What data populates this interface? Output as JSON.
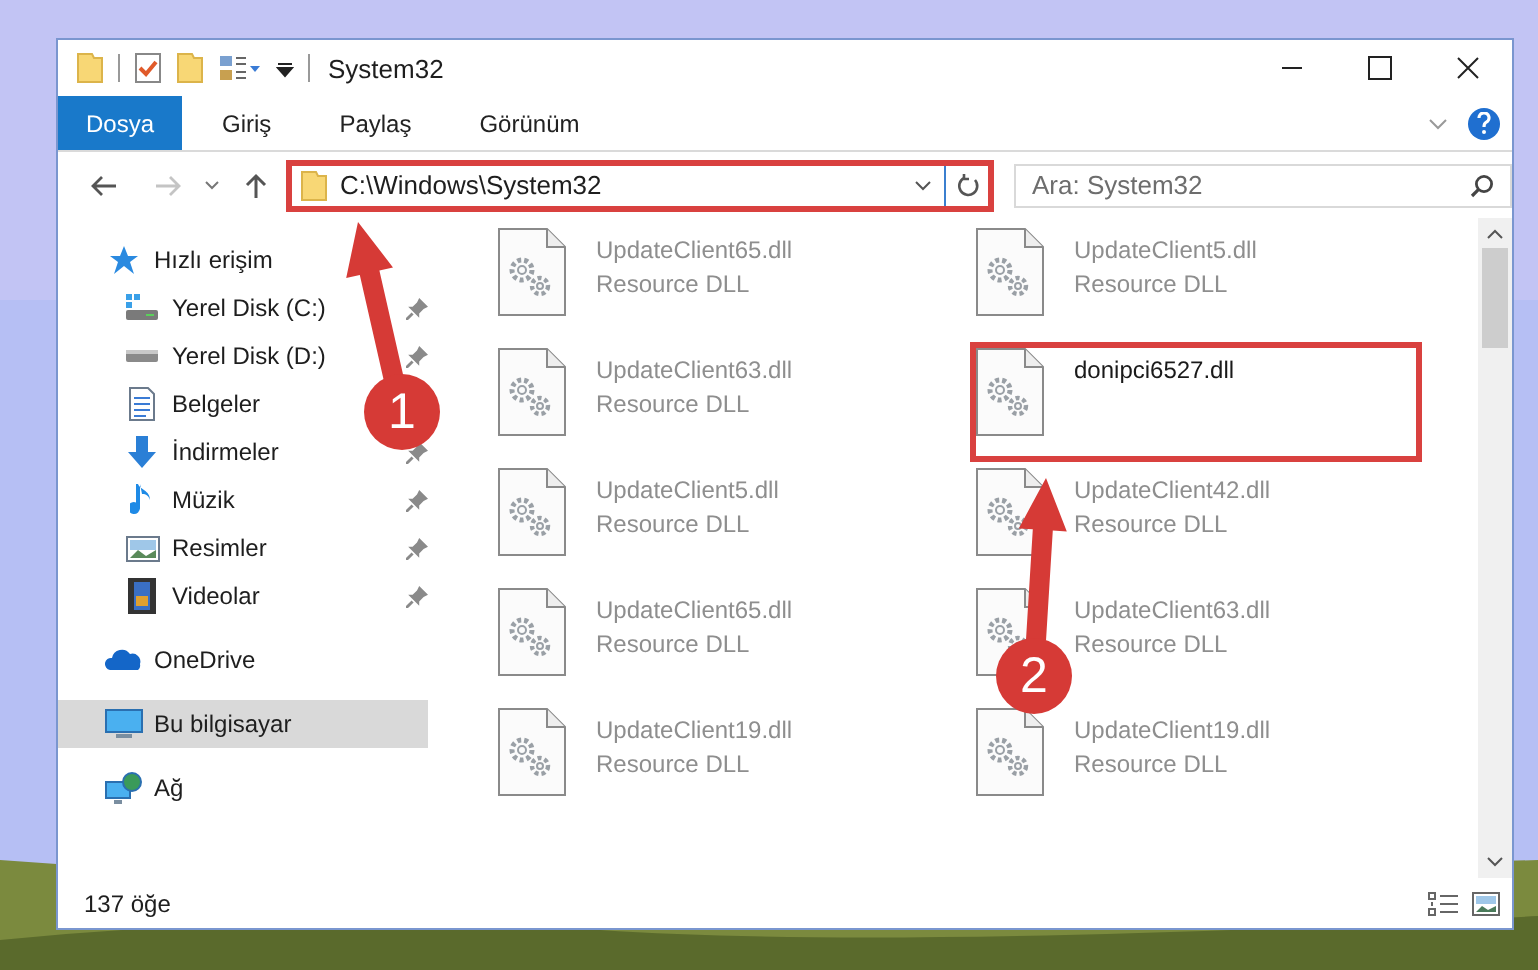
{
  "window": {
    "title": "System32"
  },
  "ribbon_tabs": [
    {
      "label": "Dosya",
      "selected": true
    },
    {
      "label": "Giriş",
      "selected": false
    },
    {
      "label": "Paylaş",
      "selected": false
    },
    {
      "label": "Görünüm",
      "selected": false
    }
  ],
  "address_bar": {
    "path": "C:\\Windows\\System32",
    "annotation_step": "1"
  },
  "search": {
    "placeholder": "Ara: System32"
  },
  "nav_pane": {
    "items": [
      {
        "label": "Hızlı erişim",
        "kind": "star",
        "selected": false,
        "children": [
          {
            "label": "Yerel Disk (C:)",
            "kind": "system-drive",
            "pinned": true,
            "selected": false
          },
          {
            "label": "Yerel Disk (D:)",
            "kind": "drive",
            "pinned": true,
            "selected": false
          },
          {
            "label": "Belgeler",
            "kind": "documents",
            "selected": false
          },
          {
            "label": "İndirmeler",
            "kind": "downloads",
            "pinned": true,
            "selected": false
          },
          {
            "label": "Müzik",
            "kind": "music",
            "pinned": true,
            "selected": false
          },
          {
            "label": "Resimler",
            "kind": "pictures",
            "pinned": true,
            "selected": false
          },
          {
            "label": "Videolar",
            "kind": "videos",
            "pinned": true,
            "selected": false
          }
        ]
      },
      {
        "label": "OneDrive",
        "kind": "cloud",
        "selected": false
      },
      {
        "label": "Bu bilgisayar",
        "kind": "computer",
        "selected": true
      },
      {
        "label": "Ağ",
        "kind": "network",
        "selected": false
      }
    ]
  },
  "files": [
    {
      "name": "UpdateClient65.dll",
      "type": "Resource DLL",
      "faded": true
    },
    {
      "name": "UpdateClient5.dll",
      "type": "Resource DLL",
      "faded": true
    },
    {
      "name": "UpdateClient63.dll",
      "type": "Resource DLL",
      "faded": true
    },
    {
      "name": "donipci6527.dll",
      "faded": false,
      "annotation_step": "2"
    },
    {
      "name": "UpdateClient5.dll",
      "type": "Resource DLL",
      "faded": true
    },
    {
      "name": "UpdateClient42.dll",
      "type": "Resource DLL",
      "faded": true
    },
    {
      "name": "UpdateClient65.dll",
      "type": "Resource DLL",
      "faded": true
    },
    {
      "name": "UpdateClient63.dll",
      "type": "Resource DLL",
      "faded": true
    },
    {
      "name": "UpdateClient19.dll",
      "type": "Resource DLL",
      "faded": true
    },
    {
      "name": "UpdateClient19.dll",
      "type": "Resource DLL",
      "faded": true
    }
  ],
  "status_bar": {
    "item_count": "137 öğe",
    "view_buttons": [
      {
        "kind": "details"
      },
      {
        "kind": "large-icons"
      }
    ]
  }
}
